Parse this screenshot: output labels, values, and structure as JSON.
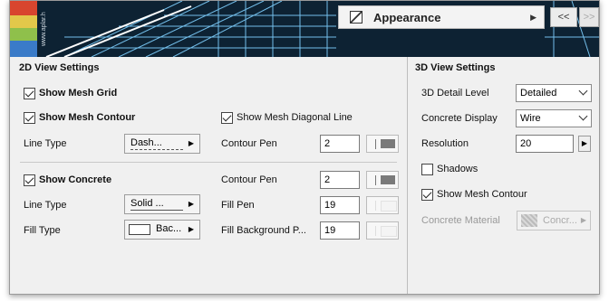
{
  "header": {
    "panel_label": "Appearance",
    "prev_label": "<<",
    "next_label": ">>",
    "banner_text": "www.aplar.h"
  },
  "view2d": {
    "title": "2D View Settings",
    "show_mesh_grid": {
      "label": "Show Mesh Grid",
      "checked": true
    },
    "show_mesh_contour": {
      "label": "Show Mesh Contour",
      "checked": true
    },
    "show_mesh_diagonal": {
      "label": "Show Mesh Diagonal Line",
      "checked": true
    },
    "line_type_label": "Line Type",
    "line_type_value": "Dash...",
    "contour_pen_label": "Contour Pen",
    "contour_pen_value": "2",
    "show_concrete": {
      "label": "Show Concrete",
      "checked": true
    },
    "concrete_contour_pen_label": "Contour Pen",
    "concrete_contour_pen_value": "2",
    "concrete_line_type_label": "Line Type",
    "concrete_line_type_value": "Solid ...",
    "fill_pen_label": "Fill Pen",
    "fill_pen_value": "19",
    "fill_type_label": "Fill Type",
    "fill_type_value": "Bac...",
    "fill_bg_pen_label": "Fill Background P...",
    "fill_bg_pen_value": "19"
  },
  "view3d": {
    "title": "3D View Settings",
    "detail_level_label": "3D Detail Level",
    "detail_level_value": "Detailed",
    "concrete_display_label": "Concrete Display",
    "concrete_display_value": "Wire",
    "resolution_label": "Resolution",
    "resolution_value": "20",
    "shadows": {
      "label": "Shadows",
      "checked": false
    },
    "show_mesh_contour": {
      "label": "Show Mesh Contour",
      "checked": true
    },
    "concrete_material_label": "Concrete Material",
    "concrete_material_value": "Concr..."
  },
  "colors": {
    "banner_bg": "#0d2233",
    "mesh_line": "#7fd0ff",
    "pen_swatch": "#7a7a7a"
  }
}
